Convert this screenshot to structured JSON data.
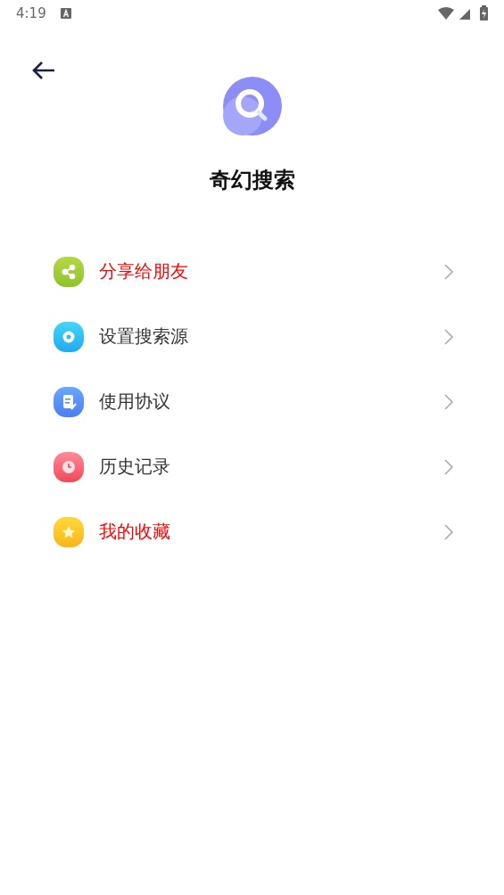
{
  "status_bar": {
    "time": "4:19"
  },
  "app": {
    "title": "奇幻搜索"
  },
  "menu": [
    {
      "label": "分享给朋友",
      "kind": "share",
      "color": "#ff0000"
    },
    {
      "label": "设置搜索源",
      "kind": "settings",
      "color": "#333333"
    },
    {
      "label": "使用协议",
      "kind": "document",
      "color": "#333333"
    },
    {
      "label": "历史记录",
      "kind": "clock",
      "color": "#333333"
    },
    {
      "label": "我的收藏",
      "kind": "star",
      "color": "#ff0000"
    }
  ]
}
